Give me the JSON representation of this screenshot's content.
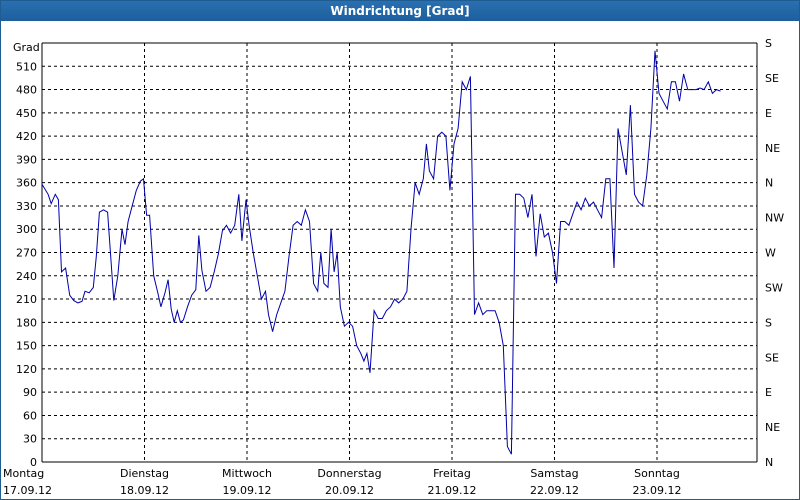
{
  "window": {
    "title": "Windrichtung [Grad]"
  },
  "colors": {
    "titlebar": "#1d5f9e",
    "line": "#0000aa",
    "grid": "#000000"
  },
  "chart_data": {
    "type": "line",
    "title": "Windrichtung [Grad]",
    "ylabel": "Grad",
    "ylim": [
      0,
      540
    ],
    "grid": true,
    "left_ticks": [
      "0",
      "30",
      "60",
      "90",
      "120",
      "150",
      "180",
      "210",
      "240",
      "270",
      "300",
      "330",
      "360",
      "390",
      "420",
      "450",
      "480",
      "510"
    ],
    "right_ticks": [
      "N",
      "NE",
      "E",
      "SE",
      "S",
      "SW",
      "W",
      "NW",
      "N",
      "NE",
      "E",
      "SE",
      "S"
    ],
    "x_day_labels": [
      {
        "day": "Montag",
        "date": "17.09.12"
      },
      {
        "day": "Dienstag",
        "date": "18.09.12"
      },
      {
        "day": "Mittwoch",
        "date": "19.09.12"
      },
      {
        "day": "Donnerstag",
        "date": "20.09.12"
      },
      {
        "day": "Freitag",
        "date": "21.09.12"
      },
      {
        "day": "Samstag",
        "date": "22.09.12"
      },
      {
        "day": "Sonntag",
        "date": "23.09.12"
      }
    ],
    "series": [
      {
        "values": [
          [
            0.0,
            358
          ],
          [
            0.06,
            345
          ],
          [
            0.09,
            333
          ],
          [
            0.13,
            345
          ],
          [
            0.16,
            338
          ],
          [
            0.19,
            245
          ],
          [
            0.23,
            250
          ],
          [
            0.27,
            215
          ],
          [
            0.31,
            208
          ],
          [
            0.35,
            205
          ],
          [
            0.39,
            207
          ],
          [
            0.42,
            220
          ],
          [
            0.46,
            218
          ],
          [
            0.5,
            225
          ],
          [
            0.53,
            265
          ],
          [
            0.56,
            322
          ],
          [
            0.6,
            325
          ],
          [
            0.64,
            322
          ],
          [
            0.67,
            265
          ],
          [
            0.7,
            208
          ],
          [
            0.74,
            240
          ],
          [
            0.78,
            300
          ],
          [
            0.81,
            280
          ],
          [
            0.84,
            310
          ],
          [
            0.88,
            330
          ],
          [
            0.92,
            350
          ],
          [
            0.96,
            362
          ],
          [
            0.99,
            365
          ],
          [
            1.02,
            318
          ],
          [
            1.05,
            318
          ],
          [
            1.09,
            240
          ],
          [
            1.13,
            218
          ],
          [
            1.16,
            200
          ],
          [
            1.2,
            218
          ],
          [
            1.23,
            235
          ],
          [
            1.26,
            197
          ],
          [
            1.29,
            180
          ],
          [
            1.32,
            195
          ],
          [
            1.35,
            180
          ],
          [
            1.38,
            183
          ],
          [
            1.42,
            200
          ],
          [
            1.46,
            215
          ],
          [
            1.5,
            222
          ],
          [
            1.53,
            292
          ],
          [
            1.56,
            247
          ],
          [
            1.6,
            220
          ],
          [
            1.64,
            225
          ],
          [
            1.68,
            245
          ],
          [
            1.72,
            268
          ],
          [
            1.76,
            298
          ],
          [
            1.8,
            305
          ],
          [
            1.84,
            295
          ],
          [
            1.88,
            305
          ],
          [
            1.92,
            345
          ],
          [
            1.95,
            285
          ],
          [
            1.99,
            338
          ],
          [
            2.02,
            305
          ],
          [
            2.06,
            270
          ],
          [
            2.1,
            240
          ],
          [
            2.14,
            210
          ],
          [
            2.18,
            220
          ],
          [
            2.21,
            190
          ],
          [
            2.25,
            168
          ],
          [
            2.29,
            190
          ],
          [
            2.33,
            205
          ],
          [
            2.37,
            220
          ],
          [
            2.41,
            265
          ],
          [
            2.45,
            305
          ],
          [
            2.49,
            310
          ],
          [
            2.53,
            305
          ],
          [
            2.57,
            325
          ],
          [
            2.61,
            310
          ],
          [
            2.65,
            230
          ],
          [
            2.69,
            220
          ],
          [
            2.72,
            270
          ],
          [
            2.75,
            230
          ],
          [
            2.79,
            225
          ],
          [
            2.82,
            300
          ],
          [
            2.85,
            245
          ],
          [
            2.88,
            270
          ],
          [
            2.91,
            200
          ],
          [
            2.95,
            175
          ],
          [
            2.99,
            180
          ],
          [
            3.03,
            175
          ],
          [
            3.07,
            150
          ],
          [
            3.11,
            140
          ],
          [
            3.14,
            130
          ],
          [
            3.17,
            140
          ],
          [
            3.2,
            115
          ],
          [
            3.24,
            195
          ],
          [
            3.28,
            185
          ],
          [
            3.32,
            185
          ],
          [
            3.36,
            195
          ],
          [
            3.4,
            200
          ],
          [
            3.44,
            210
          ],
          [
            3.48,
            205
          ],
          [
            3.52,
            210
          ],
          [
            3.56,
            220
          ],
          [
            3.6,
            300
          ],
          [
            3.64,
            360
          ],
          [
            3.68,
            345
          ],
          [
            3.72,
            365
          ],
          [
            3.75,
            410
          ],
          [
            3.78,
            375
          ],
          [
            3.82,
            365
          ],
          [
            3.86,
            420
          ],
          [
            3.9,
            425
          ],
          [
            3.94,
            420
          ],
          [
            3.98,
            350
          ],
          [
            4.02,
            410
          ],
          [
            4.06,
            430
          ],
          [
            4.1,
            490
          ],
          [
            4.14,
            480
          ],
          [
            4.18,
            497
          ],
          [
            4.22,
            190
          ],
          [
            4.26,
            205
          ],
          [
            4.3,
            190
          ],
          [
            4.34,
            195
          ],
          [
            4.38,
            195
          ],
          [
            4.42,
            195
          ],
          [
            4.46,
            180
          ],
          [
            4.5,
            150
          ],
          [
            4.54,
            20
          ],
          [
            4.58,
            10
          ],
          [
            4.62,
            345
          ],
          [
            4.66,
            345
          ],
          [
            4.7,
            340
          ],
          [
            4.74,
            315
          ],
          [
            4.78,
            345
          ],
          [
            4.82,
            265
          ],
          [
            4.86,
            320
          ],
          [
            4.9,
            290
          ],
          [
            4.94,
            295
          ],
          [
            4.98,
            270
          ],
          [
            5.02,
            230
          ],
          [
            5.06,
            310
          ],
          [
            5.1,
            310
          ],
          [
            5.14,
            305
          ],
          [
            5.18,
            320
          ],
          [
            5.22,
            335
          ],
          [
            5.26,
            325
          ],
          [
            5.3,
            340
          ],
          [
            5.34,
            330
          ],
          [
            5.38,
            335
          ],
          [
            5.42,
            325
          ],
          [
            5.46,
            315
          ],
          [
            5.5,
            365
          ],
          [
            5.54,
            365
          ],
          [
            5.58,
            250
          ],
          [
            5.62,
            430
          ],
          [
            5.66,
            400
          ],
          [
            5.7,
            370
          ],
          [
            5.74,
            460
          ],
          [
            5.78,
            345
          ],
          [
            5.82,
            335
          ],
          [
            5.86,
            330
          ],
          [
            5.9,
            370
          ],
          [
            5.94,
            430
          ],
          [
            5.98,
            530
          ],
          [
            6.02,
            475
          ],
          [
            6.06,
            465
          ],
          [
            6.1,
            455
          ],
          [
            6.14,
            490
          ],
          [
            6.18,
            490
          ],
          [
            6.22,
            465
          ],
          [
            6.26,
            500
          ],
          [
            6.3,
            480
          ],
          [
            6.34,
            480
          ],
          [
            6.38,
            480
          ],
          [
            6.42,
            482
          ],
          [
            6.46,
            480
          ],
          [
            6.5,
            490
          ],
          [
            6.54,
            475
          ],
          [
            6.58,
            480
          ],
          [
            6.62,
            478
          ]
        ]
      }
    ]
  }
}
